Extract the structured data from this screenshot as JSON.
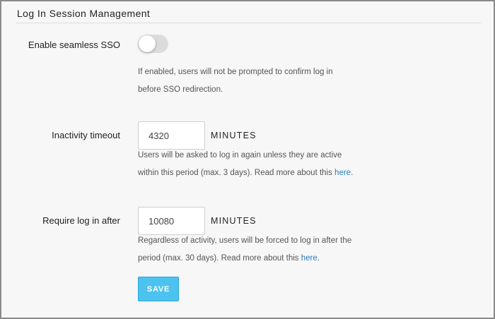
{
  "section": {
    "title": "Log In Session Management"
  },
  "sso": {
    "label": "Enable seamless SSO",
    "enabled": false,
    "help": "If enabled, users will not be prompted to confirm log in before SSO redirection."
  },
  "inactivity": {
    "label": "Inactivity timeout",
    "value": "4320",
    "unit": "MINUTES",
    "help": "Users will be asked to log in again unless they are active within this period (max. 3 days). Read more about this ",
    "link": "here",
    "suffix": "."
  },
  "require_login": {
    "label": "Require log in after",
    "value": "10080",
    "unit": "MINUTES",
    "help": "Regardless of activity, users will be forced to log in after the period (max. 30 days). Read more about this ",
    "link": "here",
    "suffix": "."
  },
  "actions": {
    "save_label": "SAVE"
  },
  "colors": {
    "accent": "#4cc3ef",
    "link": "#2a7fc1",
    "toggle_off": "#dcdcdc"
  }
}
